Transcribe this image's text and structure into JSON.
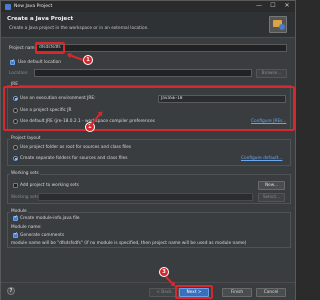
{
  "window": {
    "title": "New Java Project",
    "minimize": "—",
    "maximize": "☐",
    "close": "✕"
  },
  "header": {
    "title": "Create a Java Project",
    "subtitle": "Create a Java project in the workspace or in an external location."
  },
  "project": {
    "name_label": "Project name:",
    "name_value": "dfsdsfsdfs",
    "use_default_location": "Use default location",
    "location_label": "Location:",
    "location_value": "",
    "browse": "Browse..."
  },
  "jre": {
    "group_title": "JRE",
    "opt1": "Use an execution environment JRE:",
    "opt1_value": "JavaSE-18",
    "opt2": "Use a project specific JR",
    "opt3": "Use default JRE (jre-18.0.2.1 - workspace compiler preferences",
    "configure_link": "Configure JREs..."
  },
  "layout": {
    "group_title": "Project layout",
    "opt1": "Use project folder as root for sources and class files",
    "opt2": "Create separate folders for sources and class files",
    "configure_link": "Configure default..."
  },
  "working_sets": {
    "group_title": "Working sets",
    "add_label": "Add project to working sets",
    "new_button": "New...",
    "sets_label": "Working sets:",
    "select_button": "Select..."
  },
  "module": {
    "group_title": "Module",
    "create_label": "Create module-info.java file",
    "name_label": "Module name:",
    "generate_label": "Generate comments",
    "note": "module name will be \"dfsdsfsdfs\"  (if no module is specified, then project name will be used as module name)"
  },
  "buttons": {
    "help": "?",
    "back": "< Back",
    "next": "Next >",
    "finish": "Finish",
    "cancel": "Cancel"
  },
  "annotations": {
    "step1": "1",
    "step2": "2",
    "step3": "3"
  },
  "colors": {
    "accent": "#3a7bd5",
    "annotation": "#d6282d",
    "link": "#6aa6ee"
  }
}
